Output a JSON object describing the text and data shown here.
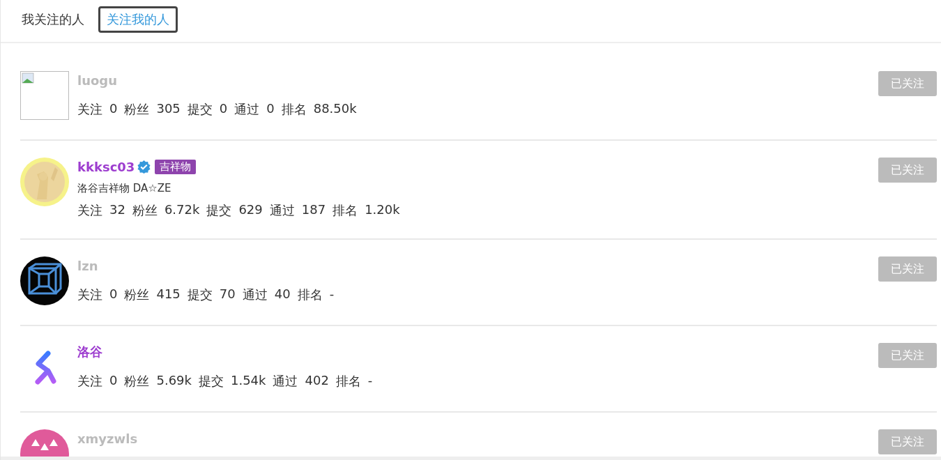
{
  "tabs": [
    {
      "label": "我关注的人",
      "selected": false
    },
    {
      "label": "关注我的人",
      "selected": true
    }
  ],
  "users": [
    {
      "name": "luogu",
      "color": "#bbbbbb",
      "avatar": {
        "kind": "broken"
      },
      "stats": [
        {
          "label": "关注",
          "value": "0"
        },
        {
          "label": "粉丝",
          "value": "305"
        },
        {
          "label": "提交",
          "value": "0"
        },
        {
          "label": "通过",
          "value": "0"
        },
        {
          "label": "排名",
          "value": "88.50k"
        }
      ],
      "button": "已关注"
    },
    {
      "name": "kkksc03",
      "color": "#9d3dcf",
      "verified": true,
      "badge": "吉祥物",
      "bio": "洛谷吉祥物 DA☆ZE",
      "stats": [
        {
          "label": "关注",
          "value": "32"
        },
        {
          "label": "粉丝",
          "value": "6.72k"
        },
        {
          "label": "提交",
          "value": "629"
        },
        {
          "label": "通过",
          "value": "187"
        },
        {
          "label": "排名",
          "value": "1.20k"
        }
      ],
      "button": "已关注"
    },
    {
      "name": "lzn",
      "color": "#bbbbbb",
      "avatar": {
        "kind": "cube"
      },
      "stats": [
        {
          "label": "关注",
          "value": "0"
        },
        {
          "label": "粉丝",
          "value": "415"
        },
        {
          "label": "提交",
          "value": "70"
        },
        {
          "label": "通过",
          "value": "40"
        },
        {
          "label": "排名",
          "value": "-"
        }
      ],
      "button": "已关注"
    },
    {
      "name": "洛谷",
      "color": "#9d3dcf",
      "avatar": {
        "kind": "logo"
      },
      "stats": [
        {
          "label": "关注",
          "value": "0"
        },
        {
          "label": "粉丝",
          "value": "5.69k"
        },
        {
          "label": "提交",
          "value": "1.54k"
        },
        {
          "label": "通过",
          "value": "402"
        },
        {
          "label": "排名",
          "value": "-"
        }
      ],
      "button": "已关注"
    },
    {
      "name": "xmyzwls",
      "color": "#bbbbbb",
      "avatar": {
        "kind": "pattern"
      },
      "button": "已关注"
    }
  ]
}
